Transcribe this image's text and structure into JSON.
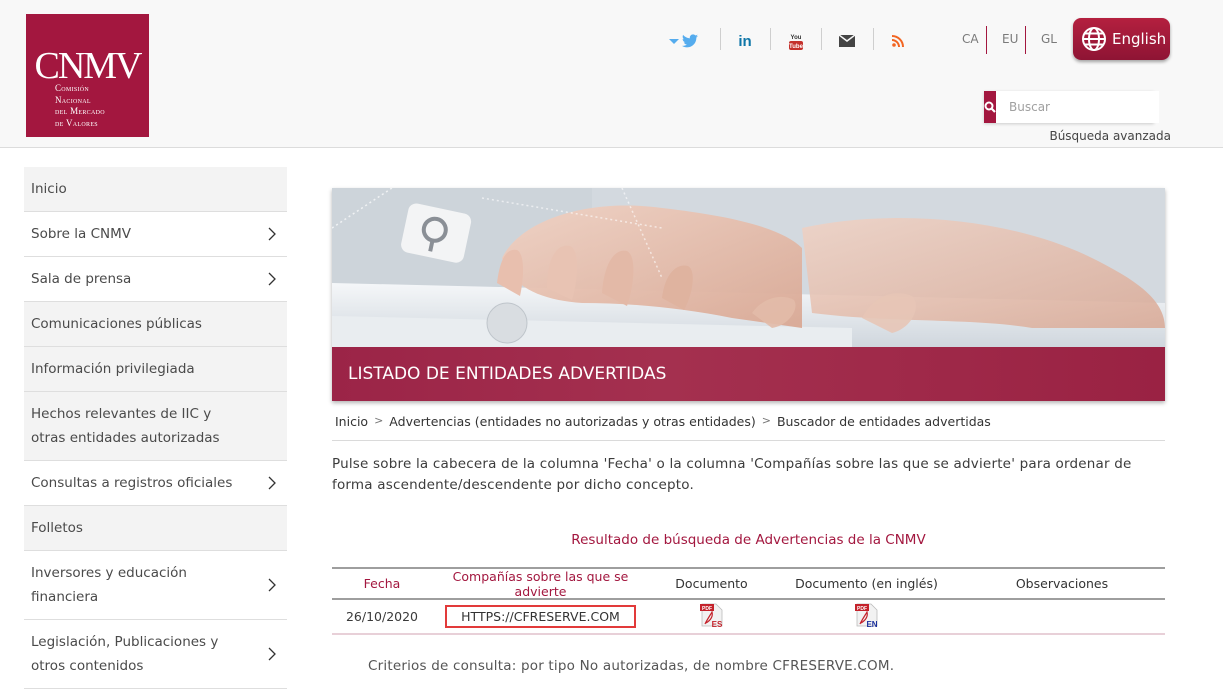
{
  "logo": {
    "acronym": "CNMV",
    "line1": "Comisión",
    "line2": "Nacional",
    "line3": "del Mercado",
    "line4": "de Valores"
  },
  "social": [
    {
      "name": "twitter-icon"
    },
    {
      "name": "linkedin-icon",
      "label": "in"
    },
    {
      "name": "youtube-icon"
    },
    {
      "name": "email-icon"
    },
    {
      "name": "rss-icon"
    }
  ],
  "languages": [
    "CA",
    "EU",
    "GL"
  ],
  "english_button": "English",
  "search": {
    "placeholder": "Buscar",
    "advanced": "Búsqueda avanzada"
  },
  "sidebar": {
    "items": [
      {
        "label": "Inicio",
        "has_submenu": false
      },
      {
        "label": "Sobre la CNMV",
        "has_submenu": true
      },
      {
        "label": "Sala de prensa",
        "has_submenu": true
      },
      {
        "label": "Comunicaciones públicas",
        "has_submenu": false
      },
      {
        "label": "Información privilegiada",
        "has_submenu": false
      },
      {
        "label": "Hechos relevantes de IIC y otras entidades autorizadas",
        "has_submenu": false
      },
      {
        "label": "Consultas a registros oficiales",
        "has_submenu": true
      },
      {
        "label": "Folletos",
        "has_submenu": false
      },
      {
        "label": "Inversores y educación financiera",
        "has_submenu": true
      },
      {
        "label": "Legislación, Publicaciones y otros contenidos",
        "has_submenu": true
      }
    ]
  },
  "banner": {
    "title": "LISTADO DE ENTIDADES ADVERTIDAS"
  },
  "breadcrumb": {
    "items": [
      "Inicio",
      "Advertencias (entidades no autorizadas y otras entidades)",
      "Buscador de entidades advertidas"
    ],
    "separator": ">"
  },
  "instructions": "Pulse sobre la cabecera de la columna 'Fecha' o la columna 'Compañías sobre las que se advierte' para ordenar de forma ascendente/descendente por dicho concepto.",
  "results": {
    "title": "Resultado de búsqueda de Advertencias de la CNMV",
    "columns": [
      "Fecha",
      "Compañías sobre las que se advierte",
      "Documento",
      "Documento (en inglés)",
      "Observaciones"
    ],
    "rows": [
      {
        "fecha": "26/10/2020",
        "company": "HTTPS://CFRESERVE.COM",
        "doc_es_label": "ES",
        "doc_en_label": "EN",
        "observaciones": ""
      }
    ]
  },
  "criteria": "Criterios de consulta: por tipo No autorizadas, de nombre CFRESERVE.COM.",
  "colors": {
    "brand": "#a3173f",
    "highlight_border": "#e23a3a",
    "twitter": "#55acee",
    "linkedin": "#0e76a8",
    "rss": "#f26522"
  }
}
